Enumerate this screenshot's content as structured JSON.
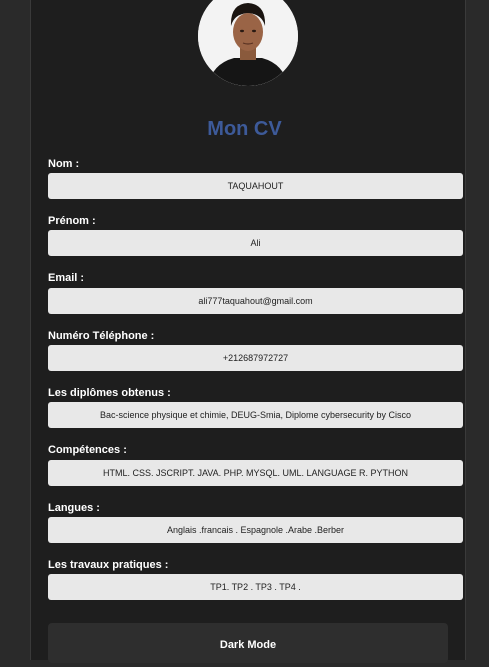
{
  "page": {
    "title": "Mon CV"
  },
  "fields": [
    {
      "label": "Nom :",
      "value": "TAQUAHOUT"
    },
    {
      "label": "Prénom :",
      "value": "Ali"
    },
    {
      "label": "Email :",
      "value": "ali777taquahout@gmail.com"
    },
    {
      "label": "Numéro Téléphone :",
      "value": "+212687972727"
    },
    {
      "label": "Les diplômes obtenus :",
      "value": "Bac-science physique et chimie, DEUG-Smia, Diplome cybersecurity by Cisco"
    },
    {
      "label": "Compétences :",
      "value": "HTML. CSS. JSCRIPT. JAVA. PHP. MYSQL. UML. LANGUAGE R. PYTHON"
    },
    {
      "label": "Langues :",
      "value": "Anglais .francais . Espagnole .Arabe .Berber"
    },
    {
      "label": "Les travaux pratiques :",
      "value": "TP1. TP2 . TP3 . TP4 ."
    }
  ],
  "dark_mode_button": {
    "label": "Dark Mode"
  },
  "colors": {
    "background": "#2a2a2a",
    "card": "#1e1e1e",
    "title": "#3d5a99",
    "field_bg": "#e8e8e8",
    "label": "#ffffff"
  }
}
